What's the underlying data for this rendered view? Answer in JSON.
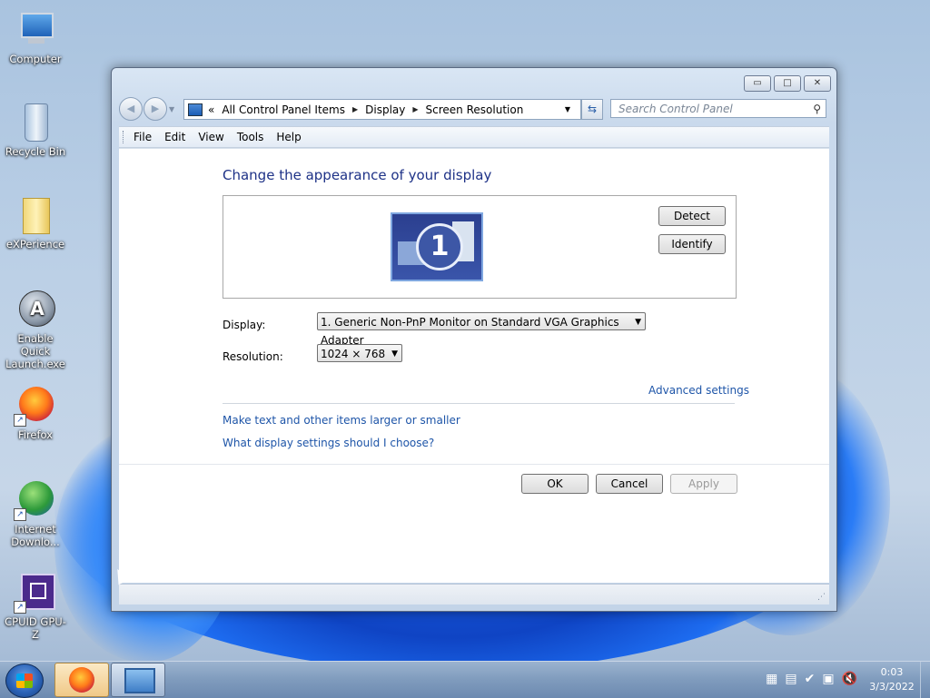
{
  "desktop": {
    "icons": [
      {
        "label": "Computer",
        "icon": "computer-icon"
      },
      {
        "label": "Recycle Bin",
        "icon": "recycle-bin-icon"
      },
      {
        "label": "eXPerience",
        "icon": "folder-icon"
      },
      {
        "label": "Enable Quick Launch.exe",
        "icon": "app-icon"
      },
      {
        "label": "Firefox",
        "icon": "firefox-icon"
      },
      {
        "label": "Internet Downlo...",
        "icon": "download-manager-icon"
      },
      {
        "label": "CPUID GPU-Z",
        "icon": "gpu-z-icon"
      }
    ]
  },
  "window": {
    "caption_buttons": {
      "minimize": "▭",
      "maximize": "□",
      "close": "✕"
    },
    "address": {
      "prefix": "«",
      "crumbs": [
        "All Control Panel Items",
        "Display",
        "Screen Resolution"
      ]
    },
    "search_placeholder": "Search Control Panel",
    "menu": [
      "File",
      "Edit",
      "View",
      "Tools",
      "Help"
    ],
    "heading": "Change the appearance of your display",
    "monitor_number": "1",
    "detect_label": "Detect",
    "identify_label": "Identify",
    "display_label": "Display:",
    "display_value": "1. Generic Non-PnP Monitor on Standard VGA Graphics Adapter",
    "resolution_label": "Resolution:",
    "resolution_value": "1024 × 768",
    "advanced_settings": "Advanced settings",
    "link_text_size": "Make text and other items larger or smaller",
    "link_choose": "What display settings should I choose?",
    "ok_label": "OK",
    "cancel_label": "Cancel",
    "apply_label": "Apply"
  },
  "taskbar": {
    "time": "0:03",
    "date": "3/3/2022"
  }
}
